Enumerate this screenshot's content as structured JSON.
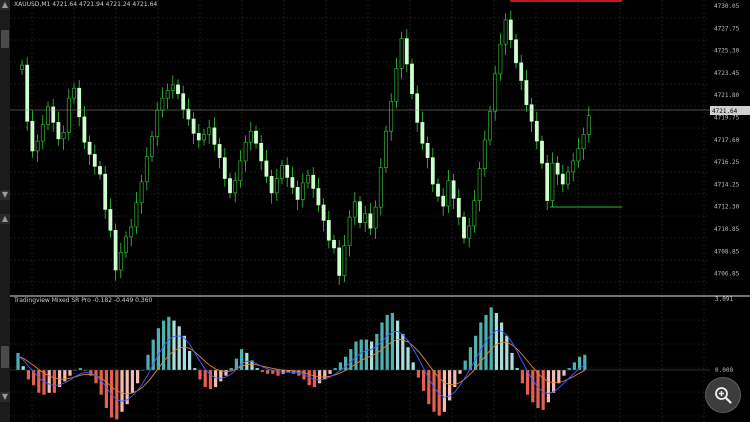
{
  "window": {
    "title": "XAUUSD,M1  4721.64 4721.94 4721.24 4721.64"
  },
  "main_chart": {
    "price_axis": [
      "4730.05",
      "4727.75",
      "4725.30",
      "4723.45",
      "4721.80",
      "4719.75",
      "4717.60",
      "4716.25",
      "4714.25",
      "4712.30",
      "4710.85",
      "4708.85",
      "4706.85"
    ],
    "current_price_label": "4721.64",
    "candles_close": [
      4726.2,
      4721.1,
      4718.4,
      4719.3,
      4720.8,
      4722.4,
      4721.0,
      4719.5,
      4720.1,
      4723.2,
      4724.1,
      4721.5,
      4719.2,
      4718.1,
      4717.0,
      4716.3,
      4713.1,
      4711.2,
      4707.6,
      4709.2,
      4710.6,
      4711.5,
      4713.7,
      4715.6,
      4717.9,
      4719.7,
      4722.1,
      4723.2,
      4723.9,
      4724.4,
      4723.6,
      4722.2,
      4721.3,
      4720.0,
      4719.4,
      4719.9,
      4720.5,
      4719.0,
      4717.8,
      4715.9,
      4714.6,
      4715.7,
      4717.5,
      4719.2,
      4720.2,
      4719.1,
      4717.5,
      4716.1,
      4714.6,
      4715.9,
      4717.1,
      4716.0,
      4715.1,
      4714.0,
      4715.5,
      4716.2,
      4715.0,
      4713.5,
      4712.1,
      4710.3,
      4709.6,
      4707.1,
      4709.8,
      4712.4,
      4713.8,
      4711.9,
      4712.7,
      4711.4,
      4713.3,
      4716.9,
      4720.2,
      4722.9,
      4725.9,
      4728.6,
      4726.3,
      4723.6,
      4721.0,
      4719.1,
      4717.8,
      4715.4,
      4714.3,
      4713.4,
      4715.7,
      4714.1,
      4712.4,
      4710.5,
      4711.6,
      4713.9,
      4716.8,
      4719.4,
      4722.0,
      4725.4,
      4728.1,
      4730.3,
      4728.5,
      4726.4,
      4724.8,
      4722.6,
      4721.1,
      4719.3,
      4717.3,
      4713.9,
      4717.3,
      4716.3,
      4715.4,
      4716.5,
      4717.5,
      4718.6,
      4719.9,
      4721.6
    ],
    "support_line": "green",
    "resistance_line": "red"
  },
  "indicator": {
    "title": "Tradingview Mixed SR Pro -0.182 -0.449 0.360",
    "scale_top": "3.091",
    "scale_zero": "0.000",
    "hist_colors": {
      "pos_up": "#4fb0b0",
      "pos_down": "#a9dede",
      "neg_down": "#e4604f",
      "neg_up": "#f2bcb3"
    },
    "signal_color": "#e08030",
    "macd_color": "#4060ff",
    "histogram": [
      0.9,
      0.2,
      -0.5,
      -0.8,
      -1.2,
      -1.3,
      -1.2,
      -1.2,
      -0.9,
      -0.6,
      -0.3,
      0.0,
      0.1,
      0.0,
      -0.3,
      -0.7,
      -1.3,
      -2.0,
      -2.5,
      -2.6,
      -2.2,
      -1.8,
      -1.2,
      -0.7,
      0.0,
      0.8,
      1.6,
      2.2,
      2.6,
      2.8,
      2.6,
      2.3,
      1.8,
      1.0,
      0.1,
      -0.5,
      -0.9,
      -1.0,
      -0.9,
      -0.6,
      -0.3,
      0.1,
      0.6,
      1.1,
      0.9,
      0.5,
      0.1,
      -0.1,
      -0.2,
      -0.2,
      -0.3,
      -0.2,
      -0.1,
      -0.2,
      -0.3,
      -0.5,
      -0.8,
      -0.9,
      -0.7,
      -0.5,
      -0.2,
      0.1,
      0.4,
      0.7,
      1.1,
      1.5,
      1.6,
      1.6,
      1.5,
      1.9,
      2.5,
      2.9,
      3.0,
      2.6,
      1.9,
      1.2,
      0.4,
      -0.4,
      -1.1,
      -1.8,
      -2.2,
      -2.4,
      -2.2,
      -1.6,
      -0.9,
      -0.2,
      0.5,
      1.2,
      1.8,
      2.5,
      2.9,
      3.3,
      3.0,
      2.5,
      1.8,
      0.9,
      0.1,
      -0.7,
      -1.3,
      -1.7,
      -2.0,
      -2.1,
      -1.7,
      -1.2,
      -0.7,
      -0.3,
      0.1,
      0.4,
      0.7,
      0.8
    ]
  },
  "zoom_button": {
    "label": "zoom"
  }
}
